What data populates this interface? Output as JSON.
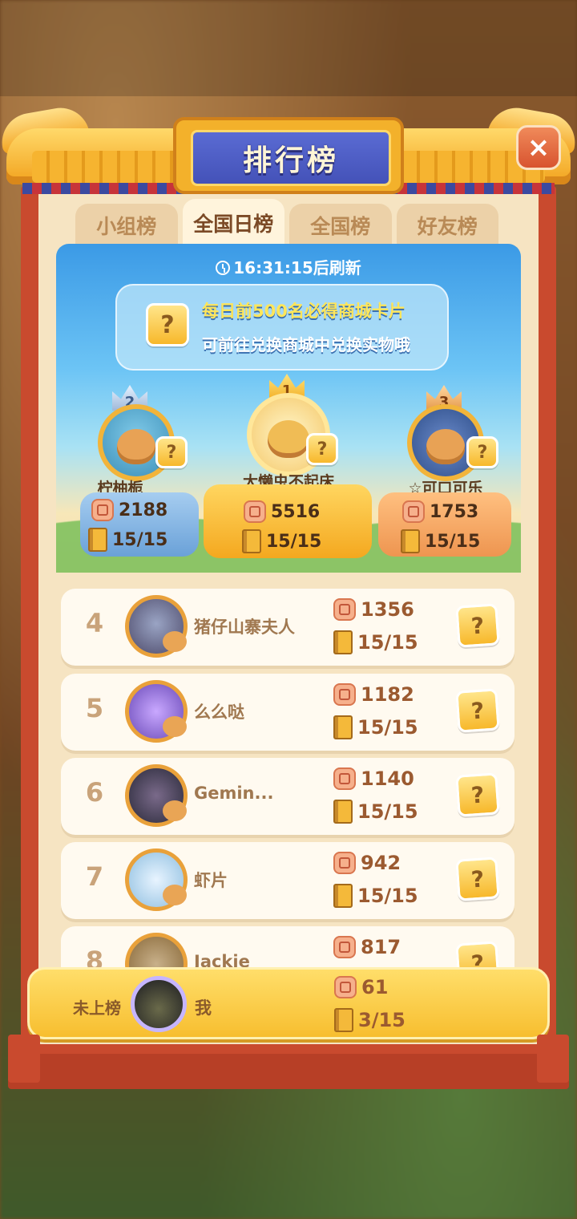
{
  "title": "排行榜",
  "close_label": "×",
  "tabs": [
    {
      "label": "小组榜",
      "active": false
    },
    {
      "label": "全国日榜",
      "active": true
    },
    {
      "label": "全国榜",
      "active": false
    },
    {
      "label": "好友榜",
      "active": false
    }
  ],
  "refresh_text": "16:31:15后刷新",
  "banner": {
    "line1": "每日前500名必得商城卡片",
    "line2": "可前往兑换商城中兑换实物哦",
    "card_glyph": "?"
  },
  "podium": [
    {
      "rank": "2",
      "name": "柠柚栀",
      "score": "2188",
      "progress": "15/15",
      "crown_color": "#9fb8d8",
      "card_glyph": "?"
    },
    {
      "rank": "1",
      "name": "大懒虫不起床",
      "score": "5516",
      "progress": "15/15",
      "crown_color": "#f3b22a",
      "card_glyph": "?"
    },
    {
      "rank": "3",
      "name": "☆可口可乐",
      "score": "1753",
      "progress": "15/15",
      "crown_color": "#e59a4c",
      "card_glyph": "?"
    }
  ],
  "rows": [
    {
      "rank": "4",
      "name": "猪仔山寨夫人",
      "score": "1356",
      "progress": "15/15",
      "card_glyph": "?"
    },
    {
      "rank": "5",
      "name": "么么哒",
      "score": "1182",
      "progress": "15/15",
      "card_glyph": "?"
    },
    {
      "rank": "6",
      "name": "Gemin...",
      "score": "1140",
      "progress": "15/15",
      "card_glyph": "?"
    },
    {
      "rank": "7",
      "name": "虾片",
      "score": "942",
      "progress": "15/15",
      "card_glyph": "?"
    },
    {
      "rank": "8",
      "name": "Jackie",
      "score": "817",
      "progress": "",
      "card_glyph": "?"
    }
  ],
  "me": {
    "status": "未上榜",
    "name": "我",
    "score": "61",
    "progress": "3/15"
  },
  "colors": {
    "frame": "#c94a2e",
    "panel": "#f6e4c2",
    "gold": "#f7be2f",
    "blue_plate": "#4452b8"
  }
}
